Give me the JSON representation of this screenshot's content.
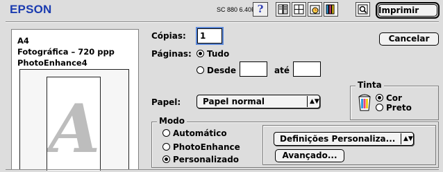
{
  "header": {
    "brand": "EPSON",
    "model": "SC 880 6.40P",
    "help_glyph": "?"
  },
  "buttons": {
    "print": "Imprimir",
    "cancel": "Cancelar",
    "advanced": "Avançado..."
  },
  "summary": {
    "paper_size": "A4",
    "quality": "Fotográfica – 720 ppp",
    "enhance": "PhotoEnhance4",
    "preview_letter": "A"
  },
  "copies": {
    "label": "Cópias:",
    "value": "1"
  },
  "pages": {
    "label": "Páginas:",
    "all_label": "Tudo",
    "from_label": "Desde",
    "to_label": "até",
    "from_value": "",
    "to_value": "",
    "selected": "all"
  },
  "paper": {
    "label": "Papel:",
    "value": "Papel normal"
  },
  "ink": {
    "title": "Tinta",
    "color_label": "Cor",
    "black_label": "Preto",
    "selected": "color"
  },
  "mode": {
    "title": "Modo",
    "automatic": "Automático",
    "photoenhance": "PhotoEnhance",
    "custom": "Personalizado",
    "selected": "custom",
    "custom_settings": "Definições Personaliza..."
  },
  "icons": [
    "help-icon",
    "layout-icon",
    "background-print-icon",
    "print-queue-icon",
    "utility-icon",
    "preview-icon",
    "ink-cartridge-icon"
  ],
  "colors": {
    "brand_blue": "#1a3bb0",
    "focus_blue": "#5c88d8",
    "window_gray": "#dddddd"
  }
}
